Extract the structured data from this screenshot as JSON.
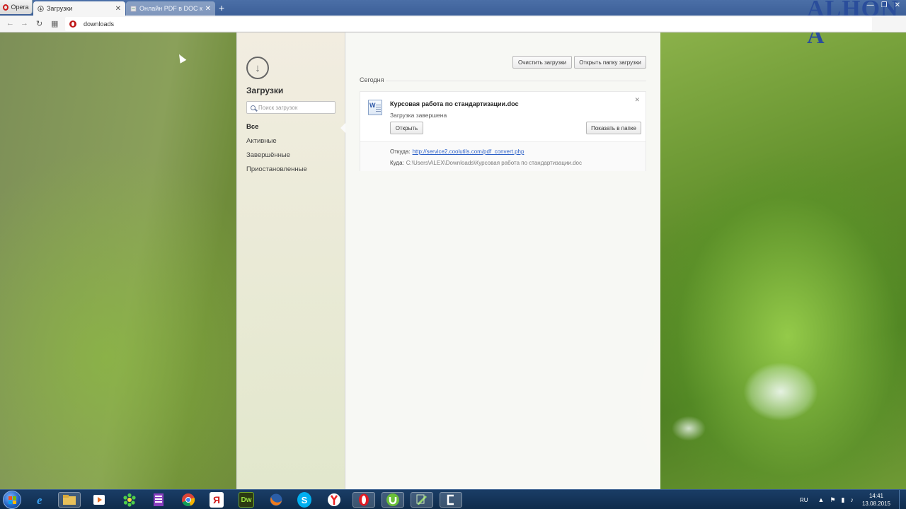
{
  "browser": {
    "menu_label": "Opera",
    "tabs": [
      {
        "label": "Загрузки",
        "close": "✕"
      },
      {
        "label": "Онлайн PDF в DOC конв",
        "close": "✕"
      }
    ],
    "new_tab": "+",
    "window_controls": [
      "—",
      "❐",
      "✕"
    ],
    "watermark": "ALHON A"
  },
  "addressbar": {
    "url": "downloads"
  },
  "sidebar": {
    "title": "Загрузки",
    "search_placeholder": "Поиск загрузок",
    "filters": [
      {
        "label": "Все",
        "selected": true
      },
      {
        "label": "Активные",
        "selected": false
      },
      {
        "label": "Завершённые",
        "selected": false
      },
      {
        "label": "Приостановленные",
        "selected": false
      }
    ]
  },
  "main": {
    "clear_button": "Очистить загрузки",
    "open_folder_button": "Открыть папку загрузки",
    "section_today": "Сегодня",
    "download": {
      "file_name": "Курсовая работа по стандартизации.doc",
      "status": "Загрузка завершена",
      "open_button": "Открыть",
      "show_in_folder_button": "Показать в папке",
      "close": "✕",
      "from_label": "Откуда:",
      "from_url": "http://service2.coolutils.com/pdf_convert.php",
      "to_label": "Куда:",
      "to_path": "C:\\Users\\ALEX\\Downloads\\Курсовая работа по стандартизации.doc"
    }
  },
  "taskbar": {
    "icons": [
      "ie-icon",
      "explorer-icon",
      "media-player-icon",
      "icq-icon",
      "archive-icon",
      "chrome-icon",
      "yandex-icon",
      "dreamweaver-icon",
      "firefox-icon",
      "skype-icon",
      "yandex-browser-icon",
      "opera-icon",
      "utorrent-icon",
      "notepad-icon",
      "camtasia-icon"
    ],
    "icon_labels": {
      "yandex": "Я",
      "dreamweaver": "Dw",
      "skype": "S"
    },
    "language": "RU",
    "time": "14:41",
    "date": "13.08.2015"
  },
  "colors": {
    "tabbar": "#3c5f98",
    "link": "#2b5fc7",
    "opera_red": "#cc1b1b",
    "taskbar": "#0f2c4c"
  }
}
